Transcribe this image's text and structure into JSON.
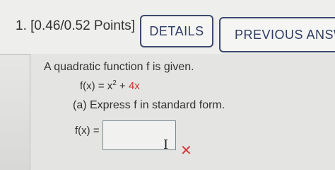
{
  "question": {
    "number": "1.",
    "points": "[0.46/0.52 Points]"
  },
  "buttons": {
    "details": "DETAILS",
    "previous": "PREVIOUS ANSW"
  },
  "problem": {
    "intro": "A quadratic function f is given.",
    "function_lhs": "f(x) = x",
    "exponent": "2",
    "plus": " + ",
    "linear_term": "4x",
    "part_a": "(a) Express f in standard form.",
    "answer_label": "f(x) =",
    "answer_value": ""
  },
  "icons": {
    "cursor": "text-cursor-icon",
    "wrong": "wrong-x-icon"
  },
  "colors": {
    "accent": "#2f3d63",
    "highlight": "#cc3333",
    "wrong": "#d03a3a"
  }
}
